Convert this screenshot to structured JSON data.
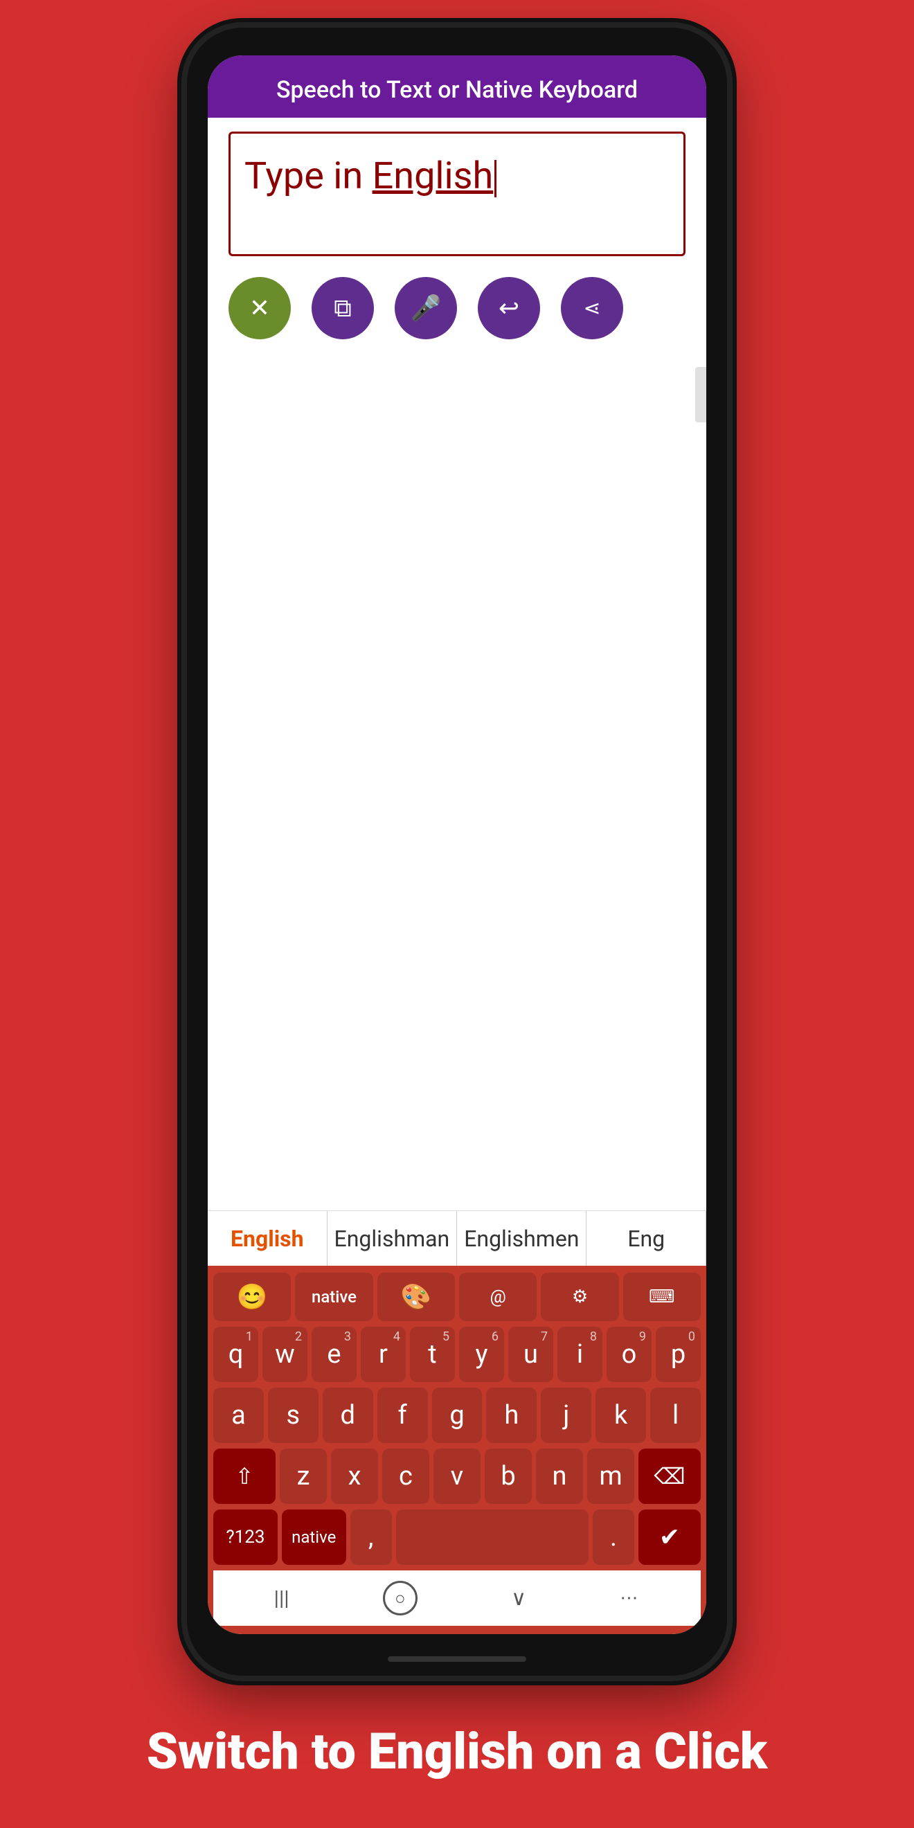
{
  "header": {
    "title": "Speech to Text or Native Keyboard"
  },
  "text_field": {
    "content_prefix": "Type in ",
    "content_highlight": "English"
  },
  "action_buttons": [
    {
      "id": "delete",
      "icon": "✕",
      "label": "delete",
      "class": "btn-delete"
    },
    {
      "id": "copy",
      "icon": "⧉",
      "label": "copy",
      "class": "btn-copy"
    },
    {
      "id": "mic",
      "icon": "🎤",
      "label": "microphone",
      "class": "btn-mic"
    },
    {
      "id": "undo",
      "icon": "↩",
      "label": "undo",
      "class": "btn-undo"
    },
    {
      "id": "share",
      "icon": "〈",
      "label": "share",
      "class": "btn-share"
    }
  ],
  "autocomplete": {
    "items": [
      {
        "text": "English",
        "active": true
      },
      {
        "text": "Englishman",
        "active": false
      },
      {
        "text": "Englishmen",
        "active": false
      },
      {
        "text": "Eng",
        "active": false,
        "truncated": true
      }
    ]
  },
  "keyboard": {
    "special_row": [
      {
        "key": "😊",
        "type": "emoji",
        "label": "emoji"
      },
      {
        "key": "native",
        "type": "text",
        "label": "native"
      },
      {
        "key": "🎨",
        "type": "emoji",
        "label": "theme"
      },
      {
        "key": "@",
        "type": "symbol",
        "label": "at"
      },
      {
        "key": "⚙",
        "type": "symbol",
        "label": "settings"
      },
      {
        "key": "⌨",
        "type": "symbol",
        "label": "keyboard"
      }
    ],
    "row1": [
      {
        "char": "q",
        "num": ""
      },
      {
        "char": "w",
        "num": ""
      },
      {
        "char": "e",
        "num": "3"
      },
      {
        "char": "r",
        "num": "4"
      },
      {
        "char": "t",
        "num": "5"
      },
      {
        "char": "y",
        "num": "6"
      },
      {
        "char": "u",
        "num": "7"
      },
      {
        "char": "i",
        "num": "8"
      },
      {
        "char": "o",
        "num": "9"
      },
      {
        "char": "p",
        "num": "0"
      }
    ],
    "row2": [
      {
        "char": "a"
      },
      {
        "char": "s"
      },
      {
        "char": "d"
      },
      {
        "char": "f"
      },
      {
        "char": "g"
      },
      {
        "char": "h"
      },
      {
        "char": "j"
      },
      {
        "char": "k"
      },
      {
        "char": "l"
      }
    ],
    "row3_left": "⇧",
    "row3_chars": [
      "z",
      "x",
      "c",
      "v",
      "b",
      "n",
      "m"
    ],
    "row3_right": "⌫",
    "row4": {
      "symbols_label": "?123",
      "native_label": "native",
      "comma": ",",
      "space": "",
      "period": ".",
      "enter_icon": "✔"
    },
    "nav": {
      "back": "|||",
      "home": "○",
      "recent": "∨",
      "grid": "⋯"
    }
  },
  "bottom_headline": "Switch to English on a Click"
}
